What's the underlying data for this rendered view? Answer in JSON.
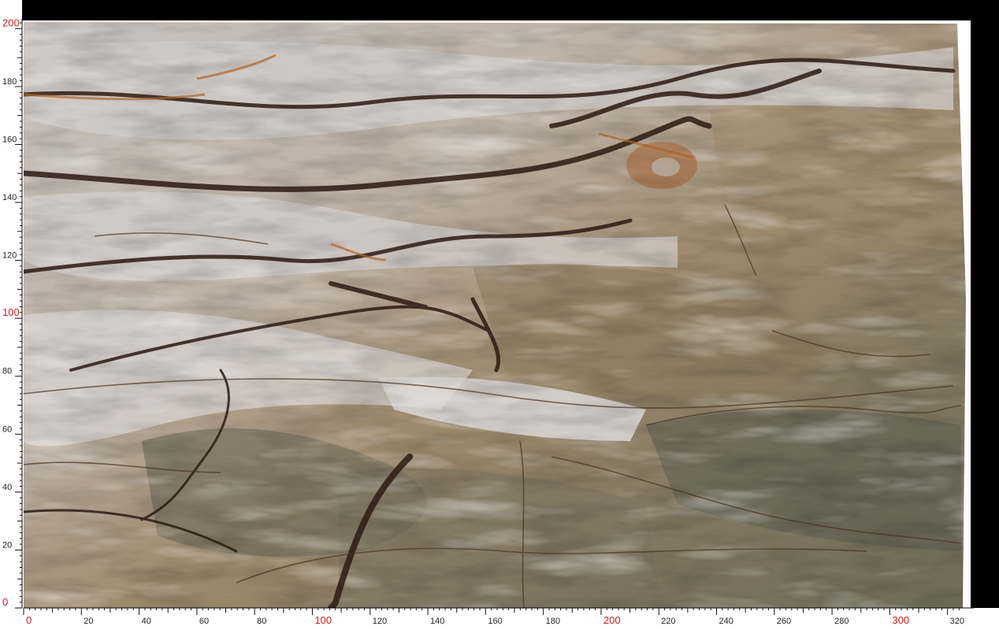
{
  "scale": {
    "unit": "cm",
    "x_axis": {
      "min": 0,
      "max": 325,
      "labels": [
        "0",
        "20",
        "40",
        "60",
        "80",
        "100",
        "120",
        "140",
        "160",
        "180",
        "200",
        "220",
        "240",
        "260",
        "280",
        "300",
        "320"
      ],
      "highlight_labels": [
        "0",
        "100",
        "200",
        "300"
      ]
    },
    "y_axis": {
      "min": 0,
      "max": 202,
      "labels": [
        "0",
        "20",
        "40",
        "60",
        "80",
        "100",
        "120",
        "140",
        "160",
        "180",
        "200"
      ],
      "highlight_labels": [
        "0",
        "100",
        "200"
      ]
    }
  },
  "colors": {
    "major_label": "#cc1f1f",
    "minor_label": "#222222",
    "frame": "#000000",
    "stone_light": "#cdc6c4",
    "stone_tan": "#9a8462",
    "stone_olive": "#7d7660",
    "vein_dark": "#2b1a12",
    "vein_rust": "#b0652a"
  }
}
